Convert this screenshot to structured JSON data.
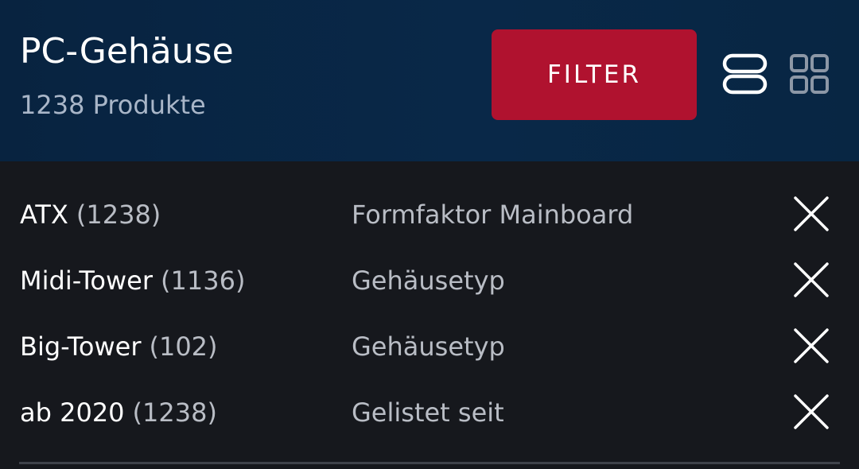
{
  "header": {
    "title": "PC-Gehäuse",
    "product_count": "1238 Produkte",
    "filter_label": "FILTER",
    "filter_color": "#b0122f",
    "view_list_icon": "list-view-icon",
    "view_grid_icon": "grid-view-icon"
  },
  "active_filters": [
    {
      "value": "ATX",
      "count": "(1238)",
      "attribute": "Formfaktor Mainboard",
      "remove_icon": "close-icon"
    },
    {
      "value": "Midi-Tower",
      "count": "(1136)",
      "attribute": "Gehäusetyp",
      "remove_icon": "close-icon"
    },
    {
      "value": "Big-Tower",
      "count": "(102)",
      "attribute": "Gehäusetyp",
      "remove_icon": "close-icon"
    },
    {
      "value": "ab 2020",
      "count": "(1238)",
      "attribute": "Gelistet seit",
      "remove_icon": "close-icon"
    }
  ]
}
